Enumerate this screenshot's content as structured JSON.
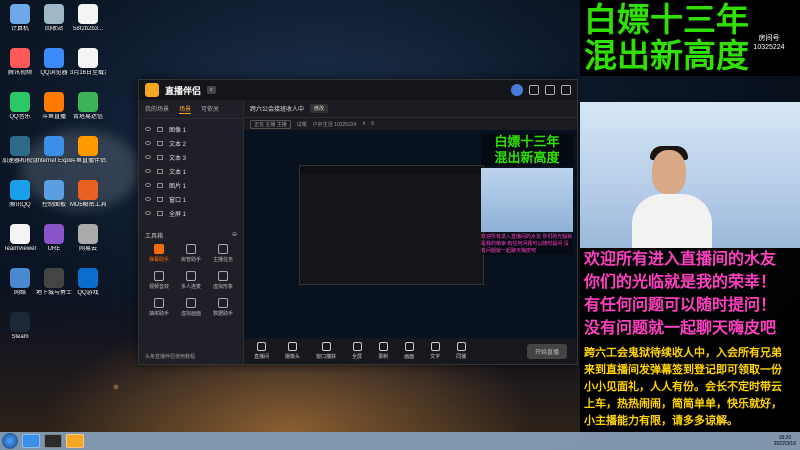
{
  "desktop_icons": [
    {
      "label": "计算机",
      "color": "#6fa8e8"
    },
    {
      "label": "回收站",
      "color": "#9fb8c8"
    },
    {
      "label": "58f2b2b3...",
      "color": "#f4f4f4"
    },
    {
      "label": "腾讯视频",
      "color": "#ff5a5a"
    },
    {
      "label": "QQ浏览器",
      "color": "#3a8af7"
    },
    {
      "label": "3月16日至载发现存",
      "color": "#f4f4f4"
    },
    {
      "label": "QQ音乐",
      "color": "#2cc868"
    },
    {
      "label": "斗鱼直播",
      "color": "#ff7a00"
    },
    {
      "label": "青塔易达信",
      "color": "#3cb35a"
    },
    {
      "label": "加速器和视觉",
      "color": "#2d6a88"
    },
    {
      "label": "Internet Explorer",
      "color": "#3b8fe6"
    },
    {
      "label": "斗鱼直播伴侣",
      "color": "#ff9a00"
    },
    {
      "label": "腾讯QQ",
      "color": "#1b9fe8"
    },
    {
      "label": "控制面板",
      "color": "#5aa0e0"
    },
    {
      "label": "MD5解密工具",
      "color": "#ea6020"
    },
    {
      "label": "TeamViewer",
      "color": "#f4f4f4"
    },
    {
      "label": "URE",
      "color": "#8854c8"
    },
    {
      "label": "网易云",
      "color": "#aaa"
    },
    {
      "label": "网络",
      "color": "#4a88d0"
    },
    {
      "label": "地下城与勇士",
      "color": "#444"
    },
    {
      "label": "QQ游戏",
      "color": "#0a6ed0"
    },
    {
      "label": "Steam",
      "color": "#1b2838"
    }
  ],
  "app": {
    "name": "直播伴侣",
    "version": "v",
    "left_tabs": [
      "我的场景",
      "场景",
      "可依关"
    ],
    "sources": [
      "图像 1",
      "文本 2",
      "文本 3",
      "文本 1",
      "图片 1",
      "窗口 1",
      "全屏 1"
    ],
    "tools_header": "工具箱",
    "tools": [
      "弹幕助手",
      "房管助手",
      "主播任务",
      "视频音效",
      "多人连麦",
      "虚拟形象",
      "抽奖助手",
      "虚拟画面",
      "数据助手"
    ],
    "footer": "头条直播伴侣使用教程",
    "stream_title": "跨六公会接班收人中",
    "edit_label": "修改",
    "meta": [
      "正在 主播 主播",
      "试菜",
      "户外生活 10325224",
      "4",
      "6"
    ],
    "controls": [
      "直播间",
      "摄像头",
      "窗口捕获",
      "全屏",
      "录制",
      "画面",
      "文字",
      "同播"
    ],
    "go_live": "开始直播"
  },
  "overlay": {
    "title_line1": "白嫖十三年",
    "title_line2": "混出新高度",
    "room_label": "房间号",
    "room_id": "10325224",
    "welcome": [
      "欢迎所有进入直播间的水友",
      "你们的光临就是我的荣幸！",
      "有任何问题可以随时提问！",
      "没有问题就一起聊天嗨皮吧"
    ],
    "notice": [
      "跨六工会鬼狱待续收人中，入会所有兄弟",
      "来到直播间发弹幕签到登记即可领取一份",
      "小小见面礼，人人有份。会长不定时带云",
      "上车，热热闹闹，简简单单，快乐就好，",
      "小主播能力有限，请多多谅解。"
    ]
  },
  "preview_overlay": {
    "title_line1": "白嫖十三年",
    "title_line2": "混出新高度",
    "text": "欢迎所有进入直播间的水友 你们的光临就是我的荣幸 有任何问题可以随时提问 没有问题就一起聊天嗨皮吧"
  },
  "taskbar": {
    "time": "18:20",
    "date": "2022/3/16"
  }
}
